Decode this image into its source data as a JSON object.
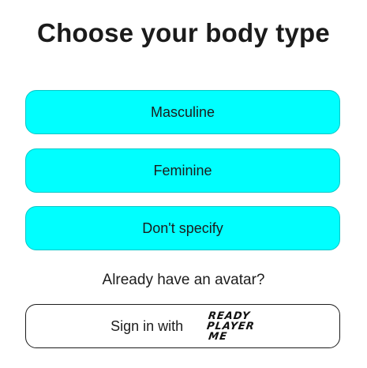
{
  "title": "Choose your body type",
  "options": [
    {
      "label": "Masculine"
    },
    {
      "label": "Feminine"
    },
    {
      "label": "Don't specify"
    }
  ],
  "existing_prompt": "Already have an avatar?",
  "signin": {
    "label": "Sign in with",
    "logo_lines": [
      "READY",
      "PLAYER",
      "ME"
    ]
  },
  "colors": {
    "option_bg": "#00ffff",
    "text": "#1c1c1c",
    "background": "#ffffff"
  }
}
